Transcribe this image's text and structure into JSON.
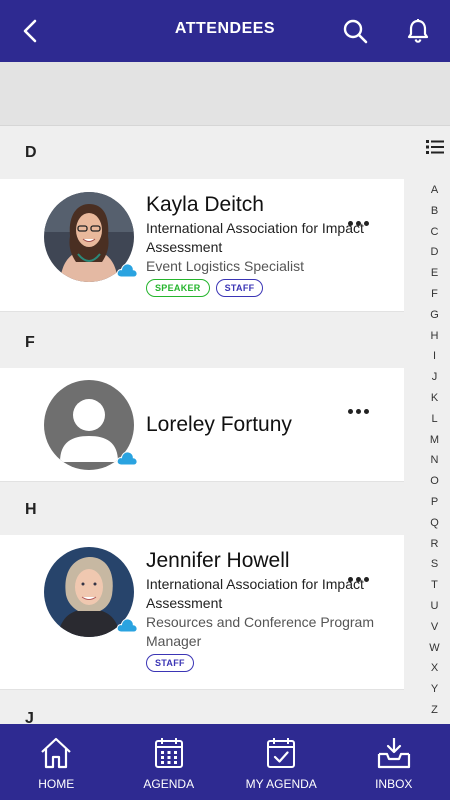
{
  "header": {
    "title": "ATTENDEES",
    "back_icon": "back-chevron-icon",
    "search_icon": "search-icon",
    "notifications_icon": "bell-icon"
  },
  "sections": [
    {
      "letter": "D",
      "attendees": [
        {
          "name": "Kayla Deitch",
          "org": "International Association for Impact Assessment",
          "role": "Event Logistics Specialist",
          "badges": [
            "SPEAKER",
            "STAFF"
          ]
        }
      ]
    },
    {
      "letter": "F",
      "attendees": [
        {
          "name": "Loreley Fortuny",
          "org": "",
          "role": "",
          "badges": []
        }
      ]
    },
    {
      "letter": "H",
      "attendees": [
        {
          "name": "Jennifer Howell",
          "org": "International Association for Impact Assessment",
          "role": "Resources and Conference Program Manager",
          "badges": [
            "STAFF"
          ]
        }
      ]
    },
    {
      "letter": "J",
      "attendees": []
    }
  ],
  "alphabet_index": [
    "A",
    "B",
    "C",
    "D",
    "E",
    "F",
    "G",
    "H",
    "I",
    "J",
    "K",
    "L",
    "M",
    "N",
    "O",
    "P",
    "Q",
    "R",
    "S",
    "T",
    "U",
    "V",
    "W",
    "X",
    "Y",
    "Z"
  ],
  "tabs": [
    {
      "label": "HOME",
      "icon": "home-icon"
    },
    {
      "label": "AGENDA",
      "icon": "calendar-icon"
    },
    {
      "label": "MY AGENDA",
      "icon": "calendar-check-icon"
    },
    {
      "label": "INBOX",
      "icon": "inbox-icon"
    }
  ],
  "colors": {
    "brand": "#2e2a91",
    "speaker_badge": "#25b52d",
    "staff_badge": "#3b35b5",
    "cloud_icon": "#2aa3e0"
  }
}
